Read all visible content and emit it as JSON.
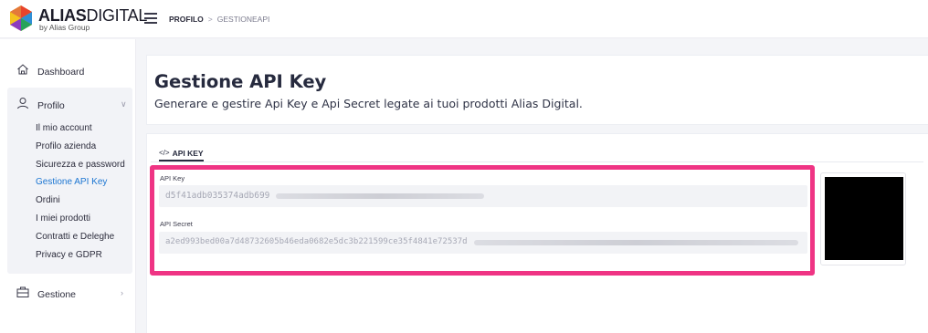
{
  "brand": {
    "name_bold": "ALIAS",
    "name_regular": "DIGITAL",
    "tagline": "by Alias Group"
  },
  "breadcrumb": {
    "items": [
      "PROFILO",
      "GESTIONEAPI"
    ],
    "separator": ">"
  },
  "sidebar": {
    "items": [
      {
        "label": "Dashboard",
        "icon": "home-icon"
      },
      {
        "label": "Profilo",
        "icon": "user-icon",
        "expanded": true
      },
      {
        "label": "Gestione",
        "icon": "briefcase-icon",
        "expanded": false
      }
    ],
    "profilo_submenu": [
      "Il mio account",
      "Profilo azienda",
      "Sicurezza e password",
      "Gestione API Key",
      "Ordini",
      "I miei prodotti",
      "Contratti e Deleghe",
      "Privacy e GDPR"
    ],
    "active_submenu": "Gestione API Key"
  },
  "page": {
    "title": "Gestione API Key",
    "subtitle": "Generare e gestire Api Key e Api Secret legate ai tuoi prodotti Alias Digital."
  },
  "tabs": [
    {
      "label": "API KEY",
      "icon": "code-icon",
      "active": true
    }
  ],
  "fields": {
    "api_key": {
      "label": "API Key",
      "value": "d5f41adb035374adb699"
    },
    "api_secret": {
      "label": "API Secret",
      "value": "a2ed993bed00a7d48732605b46eda0682e5dc3b221599ce35f4841e72537d"
    }
  },
  "colors": {
    "accent": "#1c76d2",
    "highlight": "#ef3484",
    "qr": "#000000"
  }
}
